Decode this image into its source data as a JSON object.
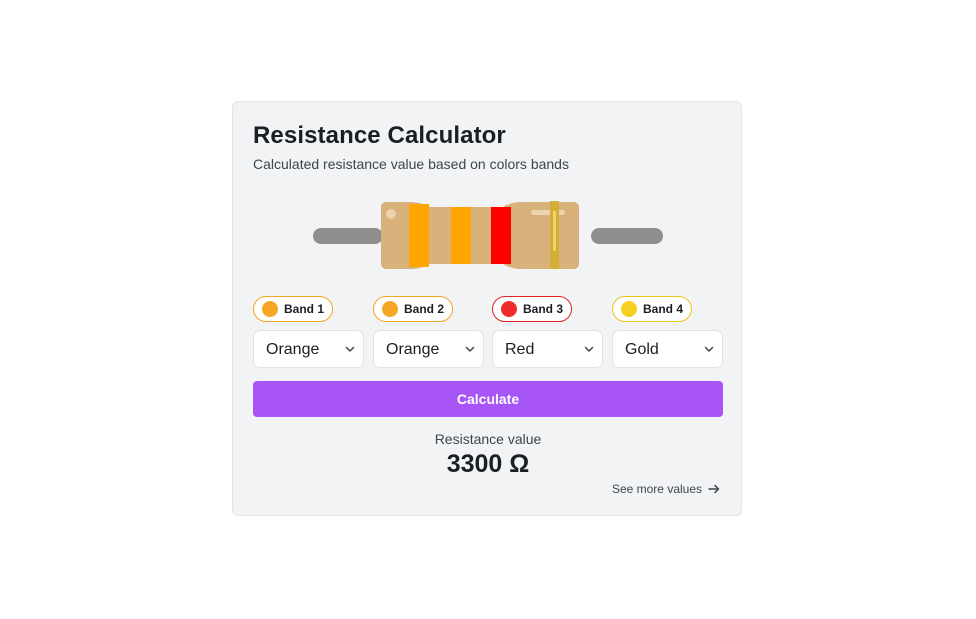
{
  "card": {
    "title": "Resistance Calculator",
    "subtitle": "Calculated resistance value based on colors bands"
  },
  "bands": [
    {
      "label": "Band 1",
      "selected": "Orange",
      "color": "#f5a623",
      "border": "#f5a623"
    },
    {
      "label": "Band 2",
      "selected": "Orange",
      "color": "#f5a623",
      "border": "#f5a623"
    },
    {
      "label": "Band 3",
      "selected": "Red",
      "color": "#ef2b2b",
      "border": "#e02424"
    },
    {
      "label": "Band 4",
      "selected": "Gold",
      "color": "#f5d020",
      "border": "#f0c419"
    }
  ],
  "resistor_colors": {
    "body": "#d8b27a",
    "lead": "#8e8e8e",
    "band1": "#ffa500",
    "band2": "#ffa500",
    "band3": "#ff0000",
    "band4": "#d4af37"
  },
  "button": {
    "label": "Calculate",
    "color": "#a855f7"
  },
  "result": {
    "label": "Resistance value",
    "value": "3300 Ω"
  },
  "link": {
    "label": "See more values"
  },
  "icons": {
    "select_chevron": "chevron-down-icon",
    "link_arrow": "arrow-right-icon"
  }
}
